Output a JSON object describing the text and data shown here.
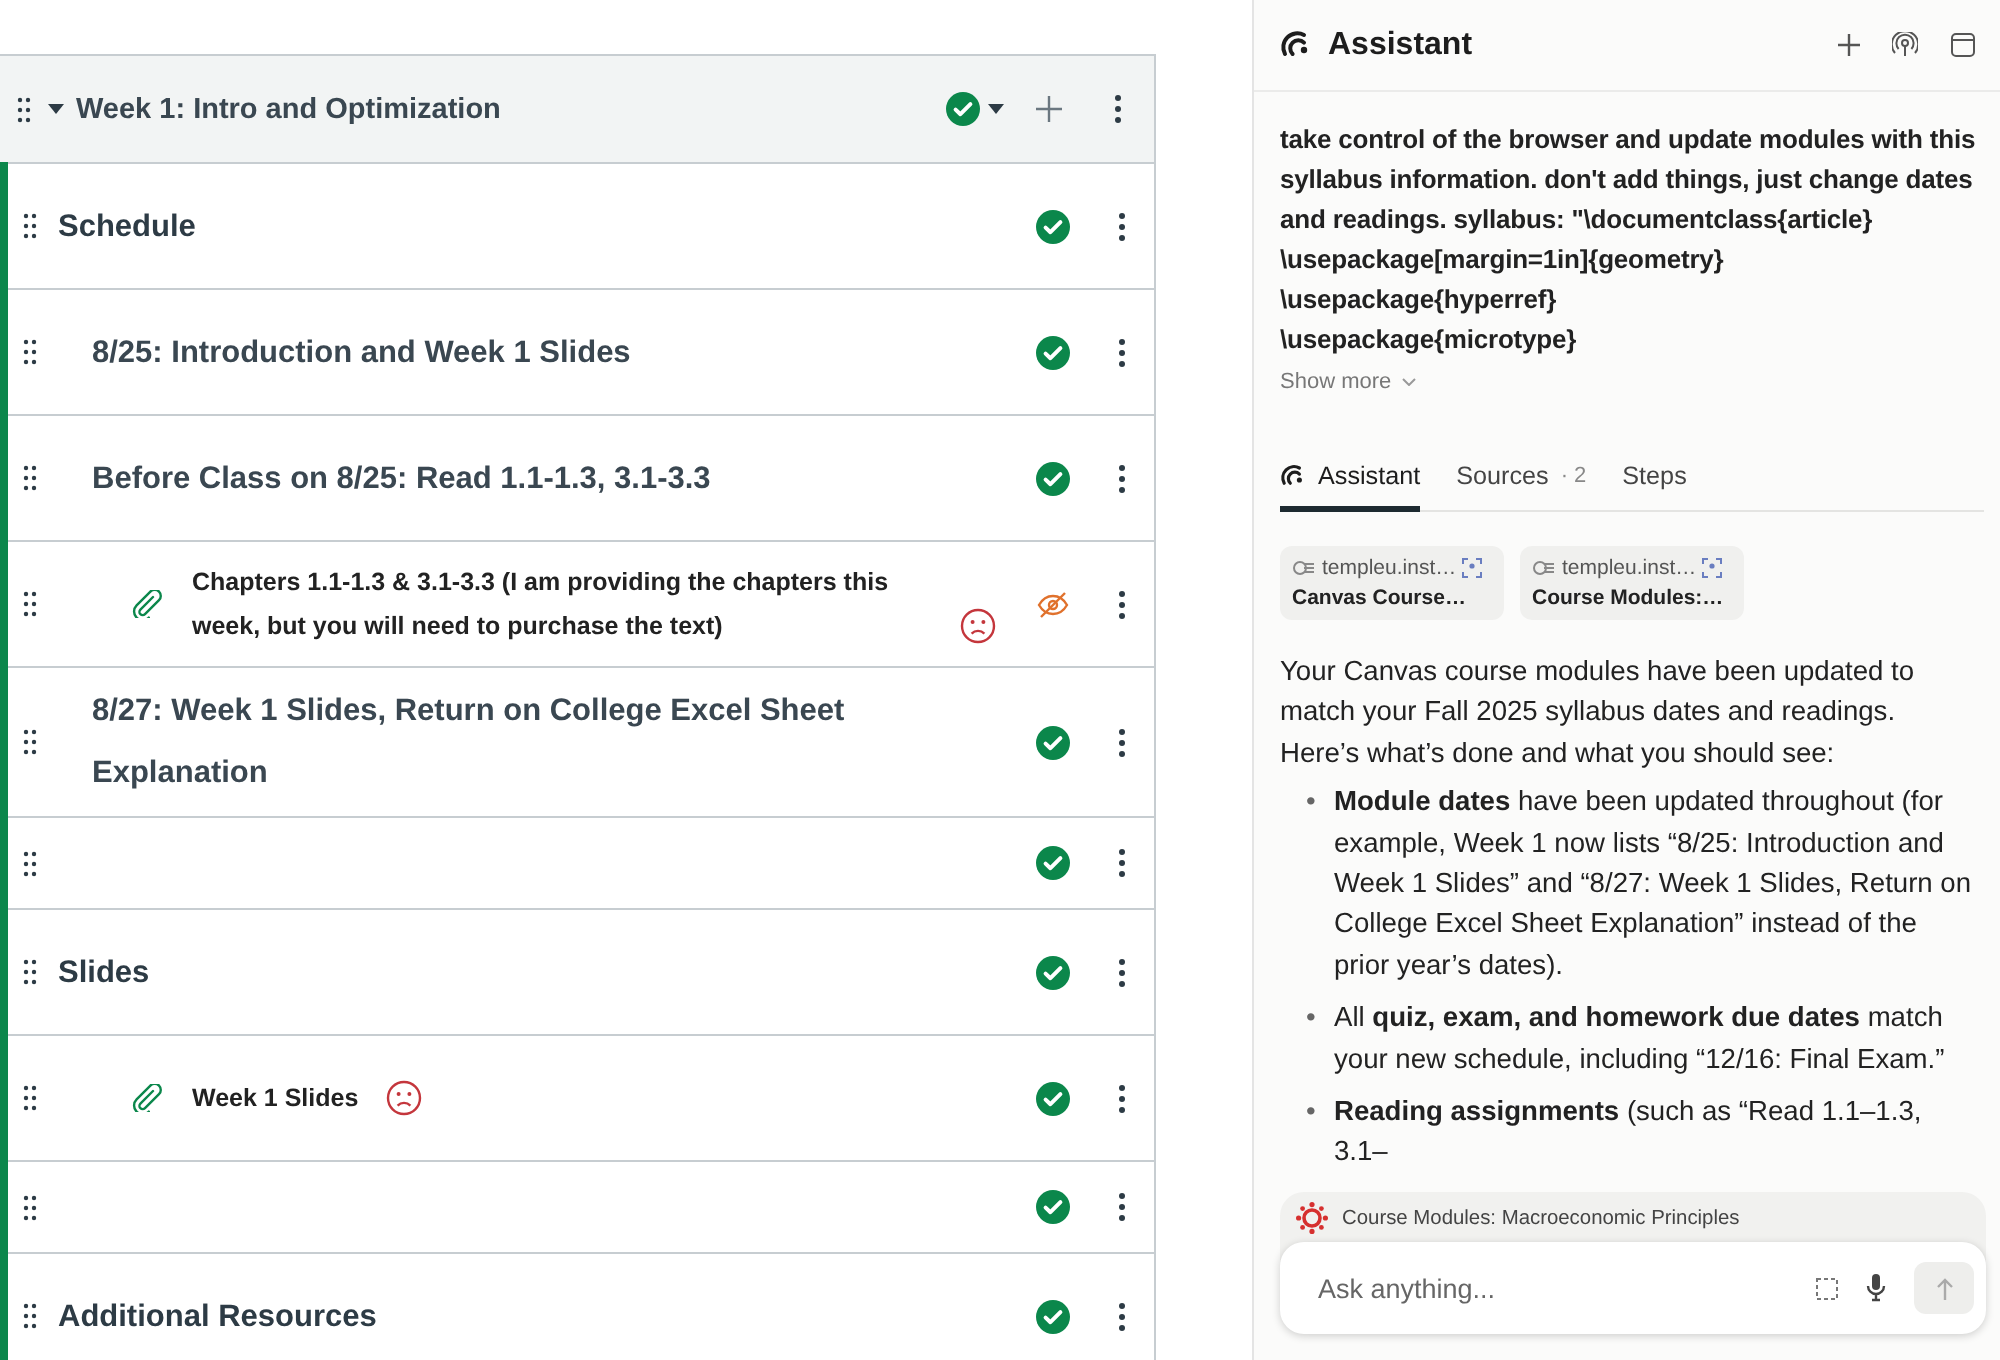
{
  "module": {
    "title": "Week 1: Intro and Optimization",
    "expanded": true,
    "published": true,
    "items": [
      {
        "kind": "subheader",
        "title": "Schedule",
        "published": true,
        "children": [
          {
            "kind": "page",
            "title": "8/25: Introduction and Week 1 Slides",
            "published": true
          },
          {
            "kind": "page",
            "title": "Before Class on 8/25: Read 1.1-1.3, 3.1-3.3",
            "published": true
          },
          {
            "kind": "attachment",
            "title": "Chapters 1.1-1.3 & 3.1-3.3 (I am providing the chapters this week, but you will need to purchase the text)",
            "published": false,
            "accessibility_issue": true
          },
          {
            "kind": "page",
            "title": "8/27: Week 1 Slides, Return on College Excel Sheet Explanation",
            "published": true
          },
          {
            "kind": "blank",
            "published": true
          }
        ]
      },
      {
        "kind": "subheader",
        "title": "Slides",
        "published": true,
        "children": [
          {
            "kind": "attachment",
            "title": "Week 1 Slides",
            "published": true,
            "accessibility_issue": true
          },
          {
            "kind": "blank",
            "published": true
          }
        ]
      },
      {
        "kind": "subheader",
        "title": "Additional Resources",
        "published": true
      }
    ]
  },
  "assistant": {
    "title": "Assistant",
    "message": "take control of the browser and update modules with this syllabus information. don't add things, just change dates and readings. syllabus: \"\\documentclass{article}\n\\usepackage[margin=1in]{geometry}\n\\usepackage{hyperref}\n\\usepackage{microtype}",
    "show_more": "Show more",
    "tabs": [
      {
        "label": "Assistant",
        "selected": true
      },
      {
        "label": "Sources",
        "count": "· 2",
        "selected": false
      },
      {
        "label": "Steps",
        "selected": false
      }
    ],
    "sources": [
      {
        "site": "templeu.inst…",
        "title": "Canvas Course…"
      },
      {
        "site": "templeu.inst…",
        "title": "Course Modules:…"
      }
    ],
    "intro": "Your Canvas course modules have been updated to match your Fall 2025 syllabus dates and readings. Here’s what’s done and what you should see:",
    "bullets": [
      {
        "marker": "•",
        "text": "**Module dates** have been updated throughout (for example, Week 1 now lists “8/25: Introduction and Week 1 Slides” and “8/27: Week 1 Slides, Return on College Excel Sheet Explanation” instead of the prior year’s dates)."
      },
      {
        "marker": "•",
        "text": "All **quiz, exam, and homework due dates** match your new schedule, including “12/16: Final Exam.”"
      },
      {
        "marker": "•",
        "text": "**Reading assignments** (such as “Read 1.1–1.3, 3.1–"
      }
    ],
    "context": "Course Modules: Macroeconomic Principles",
    "input": {
      "placeholder": "Ask anything..."
    }
  }
}
